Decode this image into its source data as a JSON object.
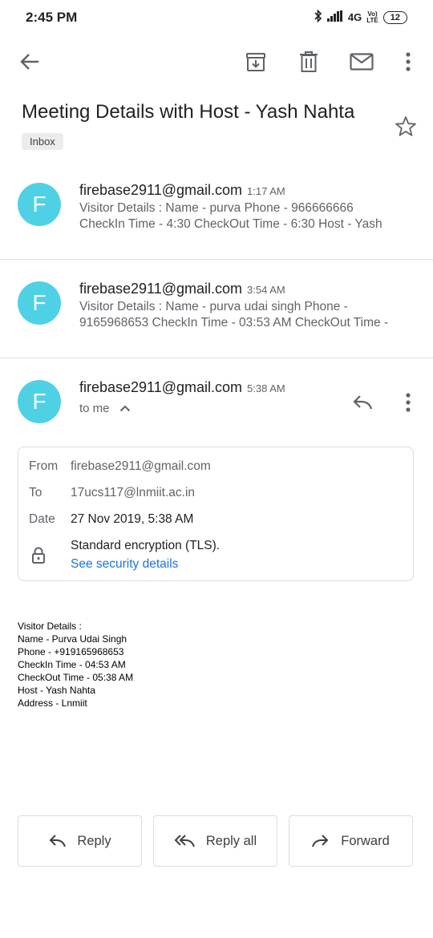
{
  "status": {
    "time": "2:45 PM",
    "network": "4G",
    "volte_top": "Vo)",
    "volte_bottom": "LTE",
    "battery": "12"
  },
  "toolbar": {
    "back": "back-arrow-icon",
    "archive": "archive-icon",
    "delete": "trash-icon",
    "unread": "mail-icon",
    "more": "more-vert-icon"
  },
  "thread": {
    "subject": "Meeting Details with Host - Yash Nahta",
    "label": "Inbox"
  },
  "messages": [
    {
      "avatar": "F",
      "sender": "firebase2911@gmail.com",
      "time": "1:17 AM",
      "line1": "Visitor Details : Name - purva Phone - 966666666",
      "line2": "CheckIn Time - 4:30 CheckOut Time - 6:30 Host - Yash"
    },
    {
      "avatar": "F",
      "sender": "firebase2911@gmail.com",
      "time": "3:54 AM",
      "line1": "Visitor Details : Name - purva udai singh Phone -",
      "line2": "9165968653 CheckIn Time - 03:53 AM CheckOut Time -"
    },
    {
      "avatar": "F",
      "sender": "firebase2911@gmail.com",
      "time": "5:38 AM",
      "recipient": "to me"
    }
  ],
  "details": {
    "from_label": "From",
    "from_value": "firebase2911@gmail.com",
    "to_label": "To",
    "to_value": "17ucs117@lnmiit.ac.in",
    "date_label": "Date",
    "date_value": "27 Nov 2019, 5:38 AM",
    "encryption": "Standard encryption (TLS).",
    "security_link": "See security details"
  },
  "body_lines": [
    "Visitor Details :",
    "Name - Purva Udai Singh",
    "Phone - +919165968653",
    "CheckIn Time - 04:53 AM",
    "CheckOut Time - 05:38 AM",
    "Host - Yash Nahta",
    "Address - Lnmiit"
  ],
  "actions": {
    "reply": "Reply",
    "reply_all": "Reply all",
    "forward": "Forward"
  },
  "colors": {
    "avatar": "#4fd1e5",
    "link": "#1a73e8"
  }
}
